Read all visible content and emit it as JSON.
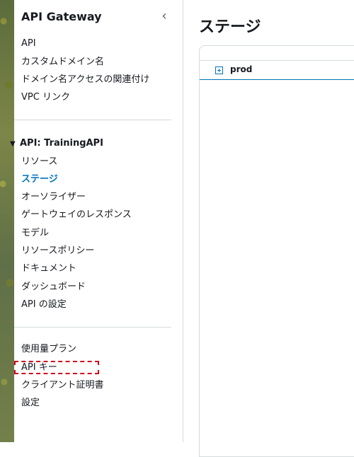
{
  "sidebar": {
    "title": "API Gateway",
    "collapse_glyph": "‹",
    "top_items": [
      {
        "label": "API"
      },
      {
        "label": "カスタムドメイン名"
      },
      {
        "label": "ドメイン名アクセスの関連付け"
      },
      {
        "label": "VPC リンク"
      }
    ],
    "section": {
      "toggle_glyph": "▼",
      "label": "API: TrainingAPI",
      "items": [
        {
          "label": "リソース"
        },
        {
          "label": "ステージ",
          "active": true
        },
        {
          "label": "オーソライザー"
        },
        {
          "label": "ゲートウェイのレスポンス"
        },
        {
          "label": "モデル"
        },
        {
          "label": "リソースポリシー"
        },
        {
          "label": "ドキュメント"
        },
        {
          "label": "ダッシュボード"
        },
        {
          "label": "API の設定"
        }
      ]
    },
    "bottom_items": [
      {
        "label": "使用量プラン"
      },
      {
        "label": "API キー",
        "highlighted": true
      },
      {
        "label": "クライアント証明書"
      },
      {
        "label": "設定"
      }
    ]
  },
  "main": {
    "page_title": "ステージ",
    "stages": [
      {
        "name": "prod"
      }
    ]
  },
  "colors": {
    "accent": "#0073bb",
    "highlight_border": "#d0021b",
    "text": "#16191f",
    "divider": "#d5dbdb"
  }
}
